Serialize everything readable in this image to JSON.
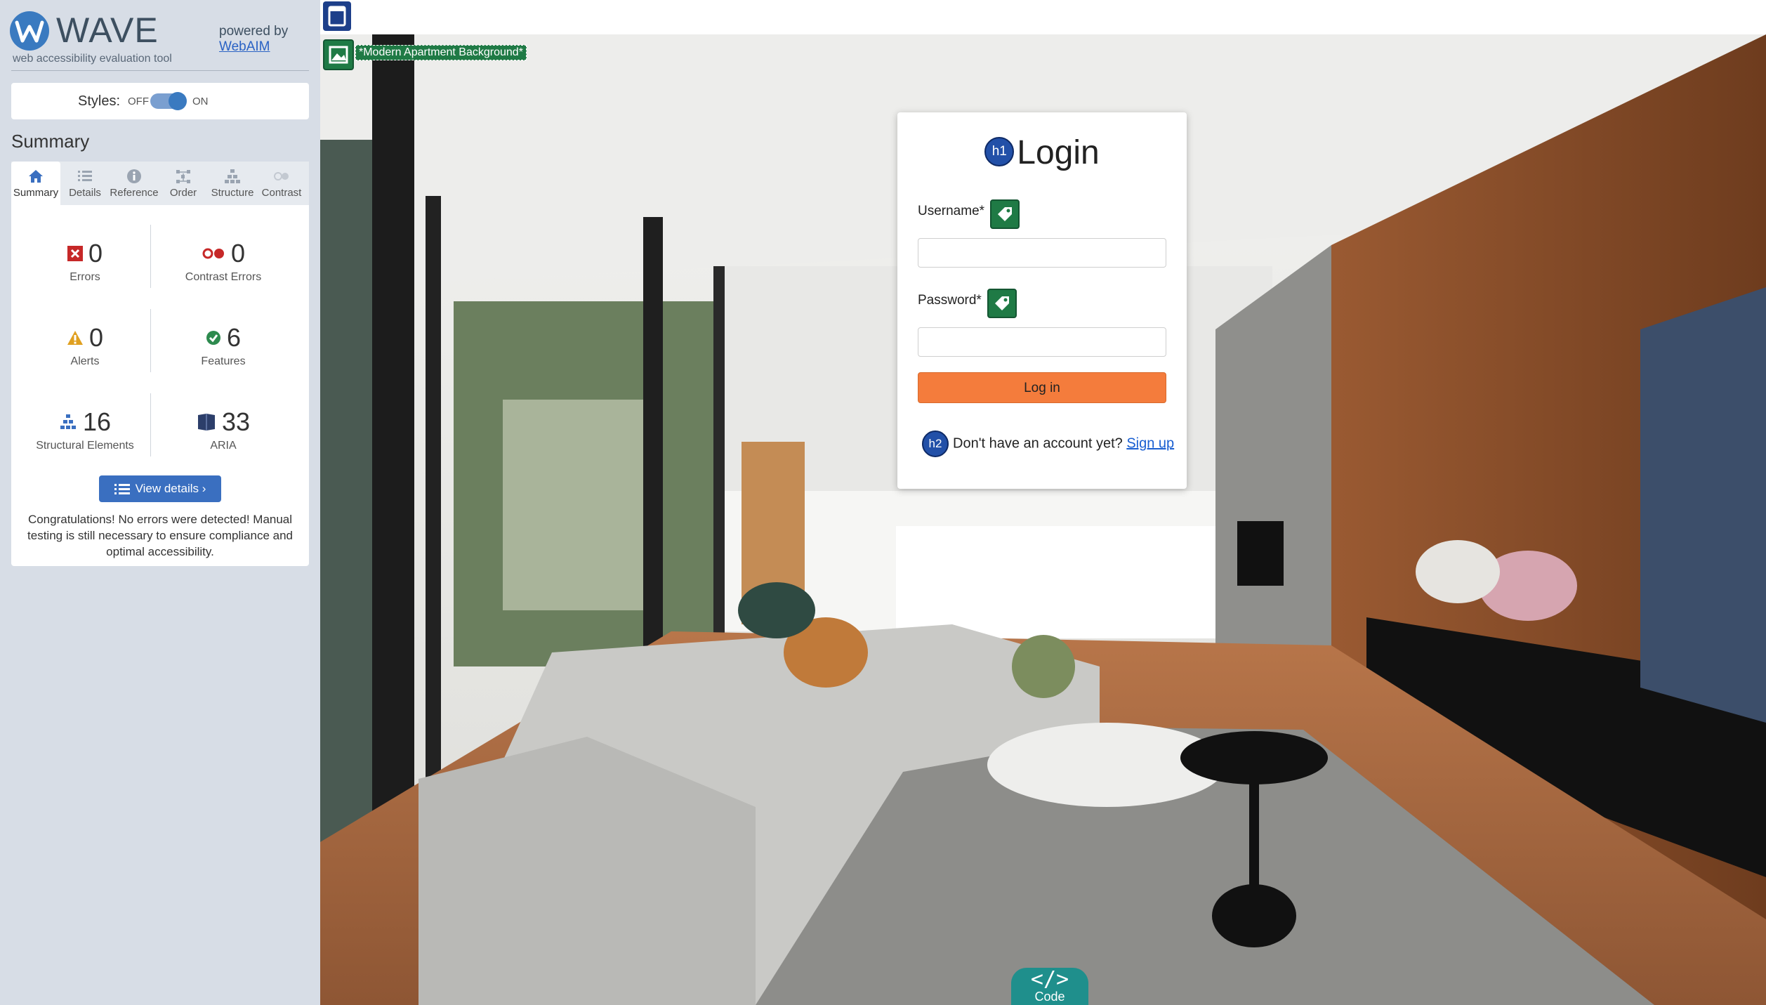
{
  "wave": {
    "title": "WAVE",
    "tagline": "web accessibility evaluation tool",
    "powered_by": "powered by",
    "webaim_link": "WebAIM",
    "styles_label": "Styles:",
    "styles_off": "OFF",
    "styles_on": "ON",
    "summary_heading": "Summary",
    "tabs": [
      {
        "label": "Summary",
        "icon": "home-icon"
      },
      {
        "label": "Details",
        "icon": "list-icon"
      },
      {
        "label": "Reference",
        "icon": "info-icon"
      },
      {
        "label": "Order",
        "icon": "order-icon"
      },
      {
        "label": "Structure",
        "icon": "structure-icon"
      },
      {
        "label": "Contrast",
        "icon": "contrast-icon"
      }
    ],
    "stats": {
      "errors": {
        "value": "0",
        "label": "Errors"
      },
      "contrast_errors": {
        "value": "0",
        "label": "Contrast Errors"
      },
      "alerts": {
        "value": "0",
        "label": "Alerts"
      },
      "features": {
        "value": "6",
        "label": "Features"
      },
      "structural": {
        "value": "16",
        "label": "Structural Elements"
      },
      "aria": {
        "value": "33",
        "label": "ARIA"
      }
    },
    "view_details": "View details ›",
    "congrats": "Congratulations! No errors were detected! Manual testing is still necessary to ensure compliance and optimal accessibility."
  },
  "page": {
    "alt_text": "*Modern Apartment Background*",
    "login": {
      "h1_badge": "h1",
      "title": "Login",
      "username_label": "Username*",
      "username_value": "",
      "password_label": "Password*",
      "password_value": "",
      "login_button": "Log in",
      "h2_badge": "h2",
      "signup_prompt": "Don't have an account yet?",
      "signup_link": "Sign up"
    },
    "code_tab": {
      "symbol": "</>",
      "label": "Code"
    }
  },
  "colors": {
    "sidebar_bg": "#d7dde6",
    "wave_blue": "#3a7ac0",
    "login_button": "#f47c3c",
    "feature_green": "#1f7a45",
    "code_teal": "#1f8f8c"
  }
}
